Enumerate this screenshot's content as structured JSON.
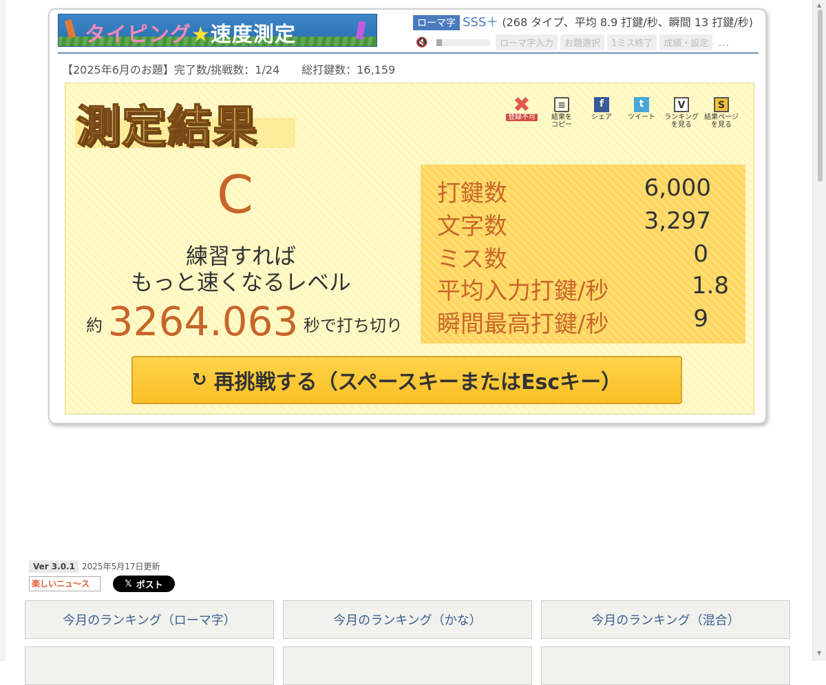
{
  "header": {
    "logo_text_a": "タイピング",
    "logo_star": "★",
    "logo_text_b": "速度測定",
    "mode_badge": "ローマ字",
    "rank": "SSS＋",
    "rank_detail": "(268 タイプ、平均 8.9 打鍵/秒、瞬間 13 打鍵/秒)",
    "sound_icon": "🔇",
    "controls": [
      "ローマ字入力",
      "お題選択",
      "1ミス終了",
      "成績・設定"
    ],
    "more_icon": "…"
  },
  "monthly": {
    "challenge": "【2025年6月のお題】完了数/挑戦数：1/24",
    "total_keys": "総打鍵数：16,159"
  },
  "result": {
    "title": "測定結果",
    "tools": [
      {
        "icon": "close-icon",
        "glyph": "✖",
        "label": "登録不可"
      },
      {
        "icon": "clipboard-icon",
        "glyph": "≡",
        "label": "結果を\nコピー"
      },
      {
        "icon": "facebook-icon",
        "glyph": "f",
        "label": "シェア"
      },
      {
        "icon": "twitter-icon",
        "glyph": "t",
        "label": "ツイート"
      },
      {
        "icon": "ranking-icon",
        "glyph": "V",
        "label": "ランキング\nを見る"
      },
      {
        "icon": "result-page-icon",
        "glyph": "S",
        "label": "結果ページ\nを見る"
      }
    ],
    "grade": "C",
    "comment_line1": "練習すれば",
    "comment_line2": "もっと速くなるレベル",
    "finish_prefix": "約",
    "finish_time": "3264.063",
    "finish_suffix": "秒で打ち切り",
    "stats": [
      {
        "label": "打鍵数",
        "value": "6,000"
      },
      {
        "label": "文字数",
        "value": "3,297"
      },
      {
        "label": "ミス数",
        "value": "0"
      },
      {
        "label": "平均入力打鍵/秒",
        "value": "1.8"
      },
      {
        "label": "瞬間最高打鍵/秒",
        "value": "9"
      }
    ],
    "retry_icon": "↻",
    "retry_label": "再挑戦する（スペースキーまたはEscキー）"
  },
  "footer": {
    "version": "Ver 3.0.1",
    "updated": "2025年5月17日更新",
    "news_logo": "楽しいニュ〜ス",
    "x_post_icon": "𝕏",
    "x_post_label": "ポスト",
    "ranking_buttons": [
      "今月のランキング（ローマ字）",
      "今月のランキング（かな）",
      "今月のランキング（混合）",
      "",
      "",
      ""
    ]
  },
  "colors": {
    "accent_blue": "#4a7bbf",
    "grade_orange": "#c8652a",
    "panel_yellow": "#fff7b8",
    "stats_yellow": "#ffd55a",
    "button_yellow": "#fbc026"
  }
}
